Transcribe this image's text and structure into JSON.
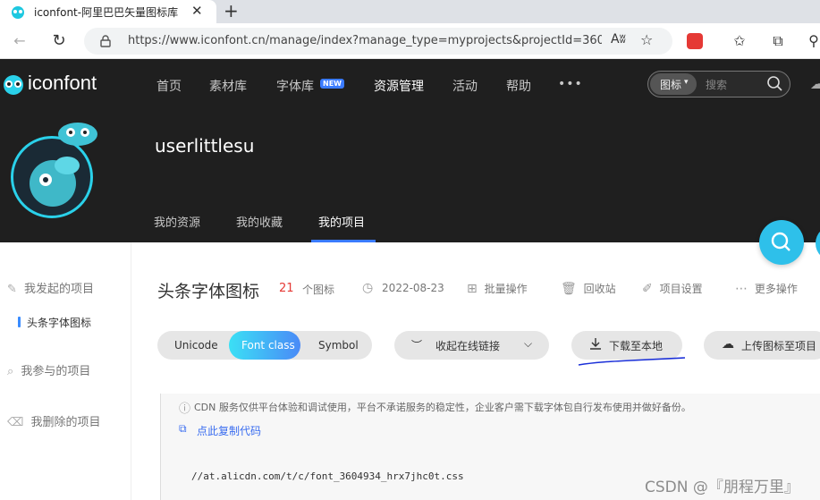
{
  "browser": {
    "tab_title": "iconfont-阿里巴巴矢量图标库",
    "new_tab": "+",
    "url": "https://www.iconfont.cn/manage/index?manage_type=myprojects&projectId=3604...",
    "reader_label": "Aʬ"
  },
  "site": {
    "logo_text": "iconfont",
    "nav": [
      "首页",
      "素材库",
      "字体库",
      "资源管理",
      "活动",
      "帮助"
    ],
    "nav_badge": "NEW",
    "more": "•••",
    "search_scope": "图标",
    "search_placeholder": "搜索"
  },
  "profile": {
    "username": "userlittlesu",
    "tabs": [
      "我的资源",
      "我的收藏",
      "我的项目"
    ]
  },
  "sidebar": {
    "items": [
      "我发起的项目",
      "头条字体图标",
      "我参与的项目",
      "我删除的项目"
    ]
  },
  "project": {
    "title": "头条字体图标",
    "count": "21",
    "count_label": "个图标",
    "date": "2022-08-23",
    "actions": [
      "批量操作",
      "回收站",
      "项目设置",
      "更多操作"
    ]
  },
  "modes": [
    "Unicode",
    "Font class",
    "Symbol"
  ],
  "buttons": {
    "collapse": "收起在线链接",
    "download": "下载至本地",
    "upload": "上传图标至项目"
  },
  "notice": "CDN 服务仅供平台体验和调试使用，平台不承诺服务的稳定性，企业客户需下载字体包自行发布使用并做好备份。",
  "copy_code": "点此复制代码",
  "css_url": "//at.alicdn.com/t/c/font_3604934_hrx7jhc0t.css",
  "watermark": "CSDN @『朋程万里』",
  "colors": {
    "accent": "#3ac2f0",
    "active_pill_from": "#3be0f5",
    "active_pill_to": "#4a8af7",
    "header_bg": "#1f1f1f"
  }
}
